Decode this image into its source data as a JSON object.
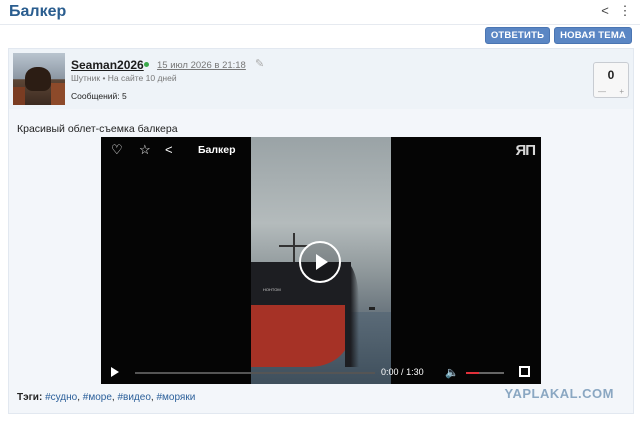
{
  "topic": {
    "title": "Балкер",
    "share_icon": "share-icon",
    "menu_icon": "more-vertical-icon"
  },
  "buttons": {
    "reply": "ОТВЕТИТЬ",
    "new_topic": "НОВАЯ ТЕМА"
  },
  "post": {
    "author": "Seaman2026",
    "date": "15 июл 2026 в 21:18",
    "meta": "Шутник • На сайте 10 дней",
    "posts_count": "Сообщений: 5",
    "rating": "0",
    "rating_minus": "—",
    "rating_plus": "+",
    "text": "Красивый облет-съемка балкера",
    "tags_label": "Тэги:",
    "tags": [
      "#судно",
      "#море",
      "#видео",
      "#моряки"
    ]
  },
  "video": {
    "title": "Балкер",
    "watermark": "ЯП",
    "hull_text": "HOHTOM",
    "time_current": "0:00",
    "time_separator": "/",
    "time_total": "1:30",
    "progress_fraction": 0,
    "volume_fraction": 0.35,
    "colors": {
      "volume": "#e0303a",
      "hull": "#a63226"
    }
  },
  "site_watermark": "YAPLAKAL.COM",
  "colors": {
    "accent": "#5a86c4",
    "title": "#2a5d8f",
    "tag": "#2b5f9a",
    "online": "#3aa84a"
  }
}
